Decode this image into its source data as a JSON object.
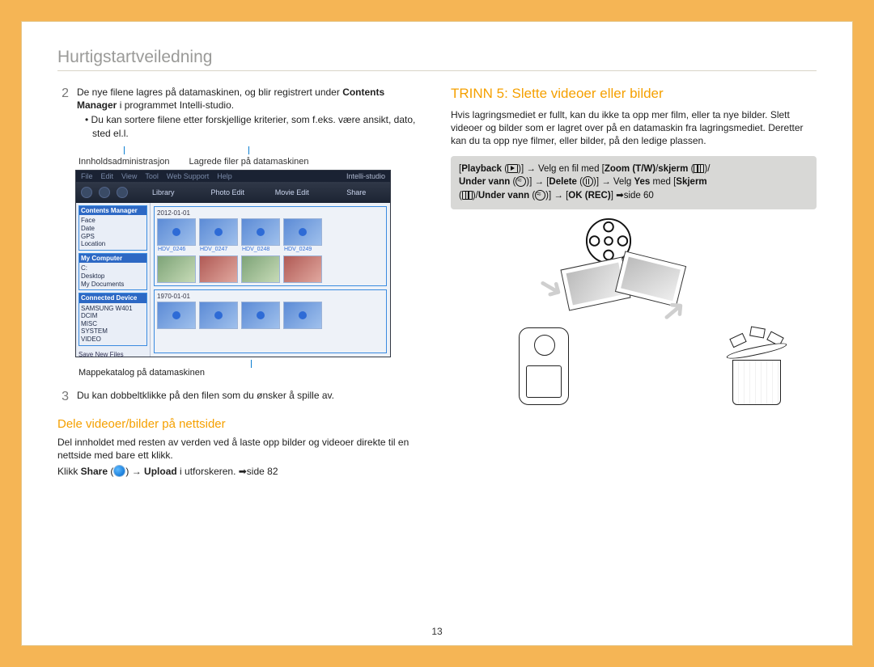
{
  "page": {
    "title": "Hurtigstartveiledning",
    "number": "13"
  },
  "left": {
    "step2_num": "2",
    "step2_a": "De nye filene lagres på datamaskinen, og blir registrert under ",
    "step2_b": "Contents Manager",
    "step2_c": " i programmet Intelli-studio.",
    "step2_bullet": "Du kan sortere filene etter forskjellige kriterier, som f.eks. være ansikt, dato, sted el.l.",
    "callout1": "Innholdsadministrasjon",
    "callout2": "Lagrede filer på datamaskinen",
    "callout3": "Mappekatalog på datamaskinen",
    "step3_num": "3",
    "step3": "Du kan dobbeltklikke på den filen som du ønsker å spille av.",
    "share_heading": "Dele videoer/bilder på nettsider",
    "share_body": "Del innholdet med resten av verden ved å laste opp bilder og videoer direkte til en nettside med bare ett klikk.",
    "share_line_a": "Klikk ",
    "share_line_share": "Share",
    "share_line_b": " (",
    "share_line_c": ") → ",
    "share_line_upload": "Upload",
    "share_line_d": " i utforskeren. ➡side 82"
  },
  "right": {
    "heading": "TRINN 5: Slette videoer eller bilder",
    "body": "Hvis lagringsmediet er fullt, kan du ikke ta opp mer film, eller ta nye bilder. Slett videoer og bilder som er lagret over på en datamaskin fra lagringsmediet. Deretter kan du ta opp nye filmer, eller bilder, på den ledige plassen.",
    "steps_l1_a": "[",
    "steps_l1_playback": "Playback",
    "steps_l1_b": " (",
    "steps_l1_c": ")] → Velg en fil med [",
    "steps_l1_zoom": "Zoom (T/W)",
    "steps_l1_d": "/",
    "steps_l1_skjerm": "skjerm",
    "steps_l1_e": " (",
    "steps_l1_f": ")/",
    "steps_l2_under": "Under vann",
    "steps_l2_a": " (",
    "steps_l2_b": ")] → [",
    "steps_l2_delete": "Delete",
    "steps_l2_c": " (",
    "steps_l2_d": ")] → Velg ",
    "steps_l2_yes": "Yes",
    "steps_l2_e": " med [",
    "steps_l2_skjerm": "Skjerm",
    "steps_l3_a": " (",
    "steps_l3_b": ")/",
    "steps_l3_under": "Under vann",
    "steps_l3_c": " (",
    "steps_l3_d": ")] → [",
    "steps_l3_ok": "OK (REC)",
    "steps_l3_e": "]  ➡side 60"
  },
  "app": {
    "menu": [
      "File",
      "Edit",
      "View",
      "Tool",
      "Web Support",
      "Help"
    ],
    "brand": "Intelli-studio",
    "tabs": [
      "Library",
      "Photo Edit",
      "Movie Edit",
      "Share"
    ],
    "tree": {
      "contents_head": "Contents Manager",
      "contents": [
        "Face",
        "Date",
        "GPS",
        "Location"
      ],
      "mycomp_head": "My Computer",
      "mycomp": [
        "C:",
        "Desktop",
        "My Documents"
      ],
      "conn_head": "Connected Device",
      "conn": [
        "SAMSUNG W401",
        "DCIM",
        "MISC",
        "SYSTEM",
        "VIDEO"
      ]
    },
    "date1": "2012-01-01",
    "date2": "1970-01-01",
    "footer_new": "Save New Files",
    "thumb_labels": [
      "HDV_0246",
      "HDV_0247",
      "HDV_0248",
      "HDV_0249"
    ]
  }
}
